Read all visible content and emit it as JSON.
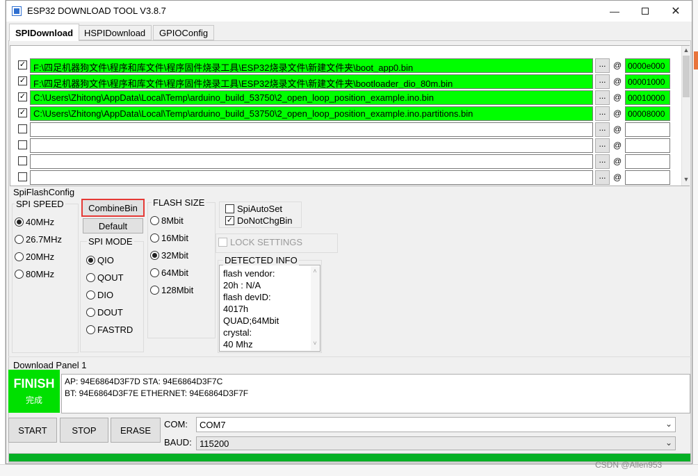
{
  "window": {
    "title": "ESP32 DOWNLOAD TOOL V3.8.7"
  },
  "tabs": [
    {
      "label": "SPIDownload",
      "active": true
    },
    {
      "label": "HSPIDownload",
      "active": false
    },
    {
      "label": "GPIOConfig",
      "active": false
    }
  ],
  "files": [
    {
      "checked": true,
      "path": "F:\\四足机器狗文件\\程序和库文件\\程序固件烧录工具\\ESP32烧录文件\\新建文件夹\\boot_app0.bin",
      "address": "0000e000",
      "ready": true
    },
    {
      "checked": true,
      "path": "F:\\四足机器狗文件\\程序和库文件\\程序固件烧录工具\\ESP32烧录文件\\新建文件夹\\bootloader_dio_80m.bin",
      "address": "00001000",
      "ready": true
    },
    {
      "checked": true,
      "path": "C:\\Users\\Zhitong\\AppData\\Local\\Temp\\arduino_build_53750\\2_open_loop_position_example.ino.bin",
      "address": "00010000",
      "ready": true
    },
    {
      "checked": true,
      "path": "C:\\Users\\Zhitong\\AppData\\Local\\Temp\\arduino_build_53750\\2_open_loop_position_example.ino.partitions.bin",
      "address": "00008000",
      "ready": true
    },
    {
      "checked": false,
      "path": "",
      "address": "",
      "ready": false
    },
    {
      "checked": false,
      "path": "",
      "address": "",
      "ready": false
    },
    {
      "checked": false,
      "path": "",
      "address": "",
      "ready": false
    },
    {
      "checked": false,
      "path": "",
      "address": "",
      "ready": false
    }
  ],
  "browse_label": "...",
  "at_label": "@",
  "spi_config": {
    "title": "SpiFlashConfig",
    "speed": {
      "label": "SPI SPEED",
      "options": [
        "40MHz",
        "26.7MHz",
        "20MHz",
        "80MHz"
      ],
      "selected": "40MHz"
    },
    "combine_label": "CombineBin",
    "default_label": "Default",
    "mode": {
      "label": "SPI MODE",
      "options": [
        "QIO",
        "QOUT",
        "DIO",
        "DOUT",
        "FASTRD"
      ],
      "selected": "QIO"
    },
    "flash_size": {
      "label": "FLASH SIZE",
      "options": [
        "8Mbit",
        "16Mbit",
        "32Mbit",
        "64Mbit",
        "128Mbit"
      ],
      "selected": "32Mbit"
    },
    "spi_autoset_label": "SpiAutoSet",
    "do_not_chg_bin_label": "DoNotChgBin",
    "lock_settings_label": "LOCK SETTINGS",
    "detected": {
      "label": "DETECTED INFO",
      "lines": [
        "flash vendor:",
        "20h : N/A",
        "flash devID:",
        "4017h",
        "QUAD;64Mbit",
        "crystal:",
        "40 Mhz"
      ]
    }
  },
  "download_panel": {
    "title": "Download Panel 1",
    "status": "FINISH",
    "status_cn": "完成",
    "log": [
      "AP:  94E6864D3F7D  STA:  94E6864D3F7C",
      "BT:  94E6864D3F7E  ETHERNET:  94E6864D3F7F"
    ],
    "start_label": "START",
    "stop_label": "STOP",
    "erase_label": "ERASE",
    "com_label": "COM:",
    "com_value": "COM7",
    "baud_label": "BAUD:",
    "baud_value": "115200",
    "progress": 1.0
  },
  "watermark": "CSDN @Allen953",
  "colors": {
    "ready": "#00ff00",
    "finish": "#00e000",
    "progress": "#06b025",
    "highlight": "#e53935"
  }
}
